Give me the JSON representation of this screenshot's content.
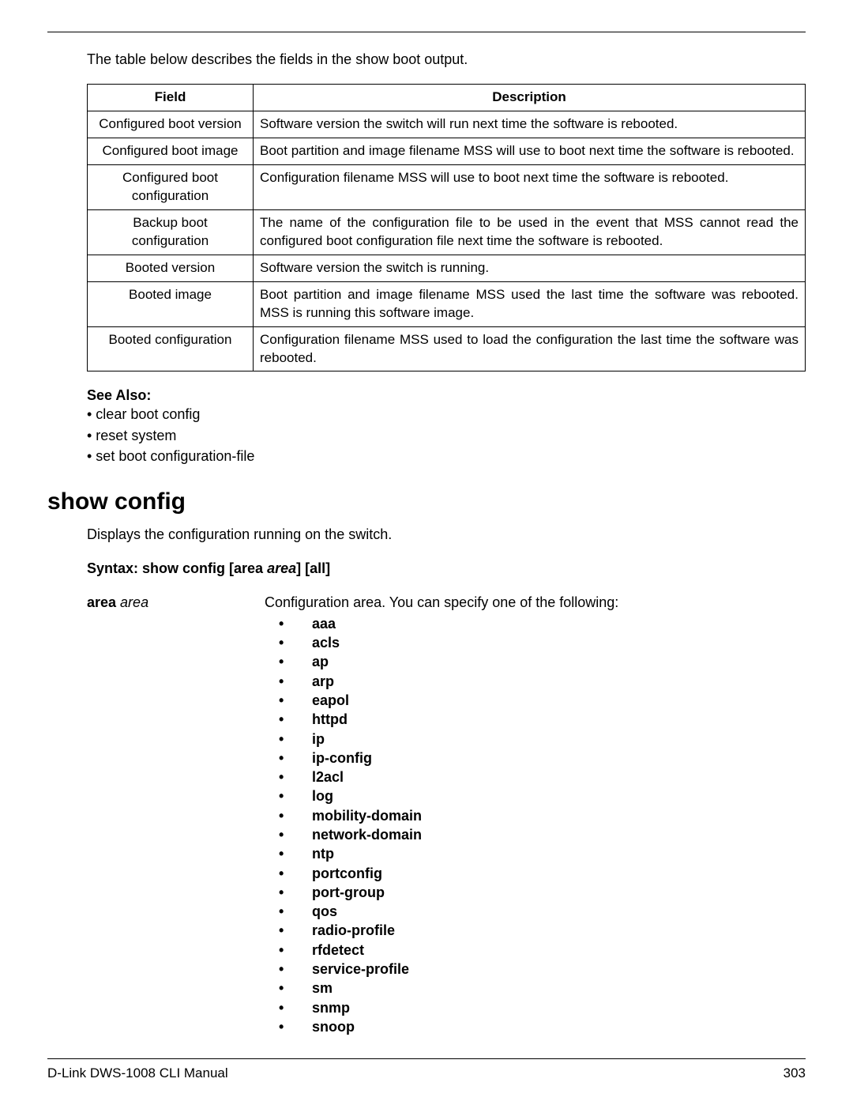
{
  "intro": "The table below describes the fields in the show boot output.",
  "table": {
    "headers": {
      "field": "Field",
      "desc": "Description"
    },
    "rows": [
      {
        "field": "Configured boot version",
        "desc": "Software version the switch will run next time the software is rebooted."
      },
      {
        "field": "Configured boot image",
        "desc": "Boot partition and image filename MSS will use to boot next time the software is rebooted."
      },
      {
        "field": "Configured boot configuration",
        "desc": "Configuration filename MSS will use to boot next time the software is rebooted."
      },
      {
        "field": "Backup boot configuration",
        "desc": "The name of the configuration file to be used in the event that MSS cannot read the configured boot configuration file next time the software is rebooted."
      },
      {
        "field": "Booted version",
        "desc": "Software version the switch is running."
      },
      {
        "field": "Booted image",
        "desc": "Boot partition and image filename MSS used the last time the software was rebooted. MSS is running this software image."
      },
      {
        "field": "Booted configuration",
        "desc": "Configuration filename MSS used to load the configuration the last time the software was rebooted."
      }
    ]
  },
  "see_also": {
    "heading": "See Also:",
    "items": [
      "clear boot config",
      "reset system",
      "set boot configuration-file"
    ]
  },
  "cmd": {
    "title": "show config",
    "desc": "Displays the configuration running on the switch.",
    "syntax_prefix": "Syntax:  show config [area ",
    "syntax_ital": "area",
    "syntax_suffix": "] [all]",
    "param_label_bold": "area ",
    "param_label_ital": "area",
    "param_lead": "Configuration area. You can specify one of the following:",
    "options": [
      "aaa",
      "acls",
      "ap",
      "arp",
      "eapol",
      "httpd",
      "ip",
      "ip-config",
      "l2acl",
      "log",
      "mobility-domain",
      "network-domain",
      "ntp",
      "portconfig",
      "port-group",
      "qos",
      "radio-profile",
      "rfdetect",
      "service-profile",
      "sm",
      "snmp",
      "snoop"
    ]
  },
  "footer": {
    "left": "D-Link DWS-1008 CLI Manual",
    "right": "303"
  }
}
